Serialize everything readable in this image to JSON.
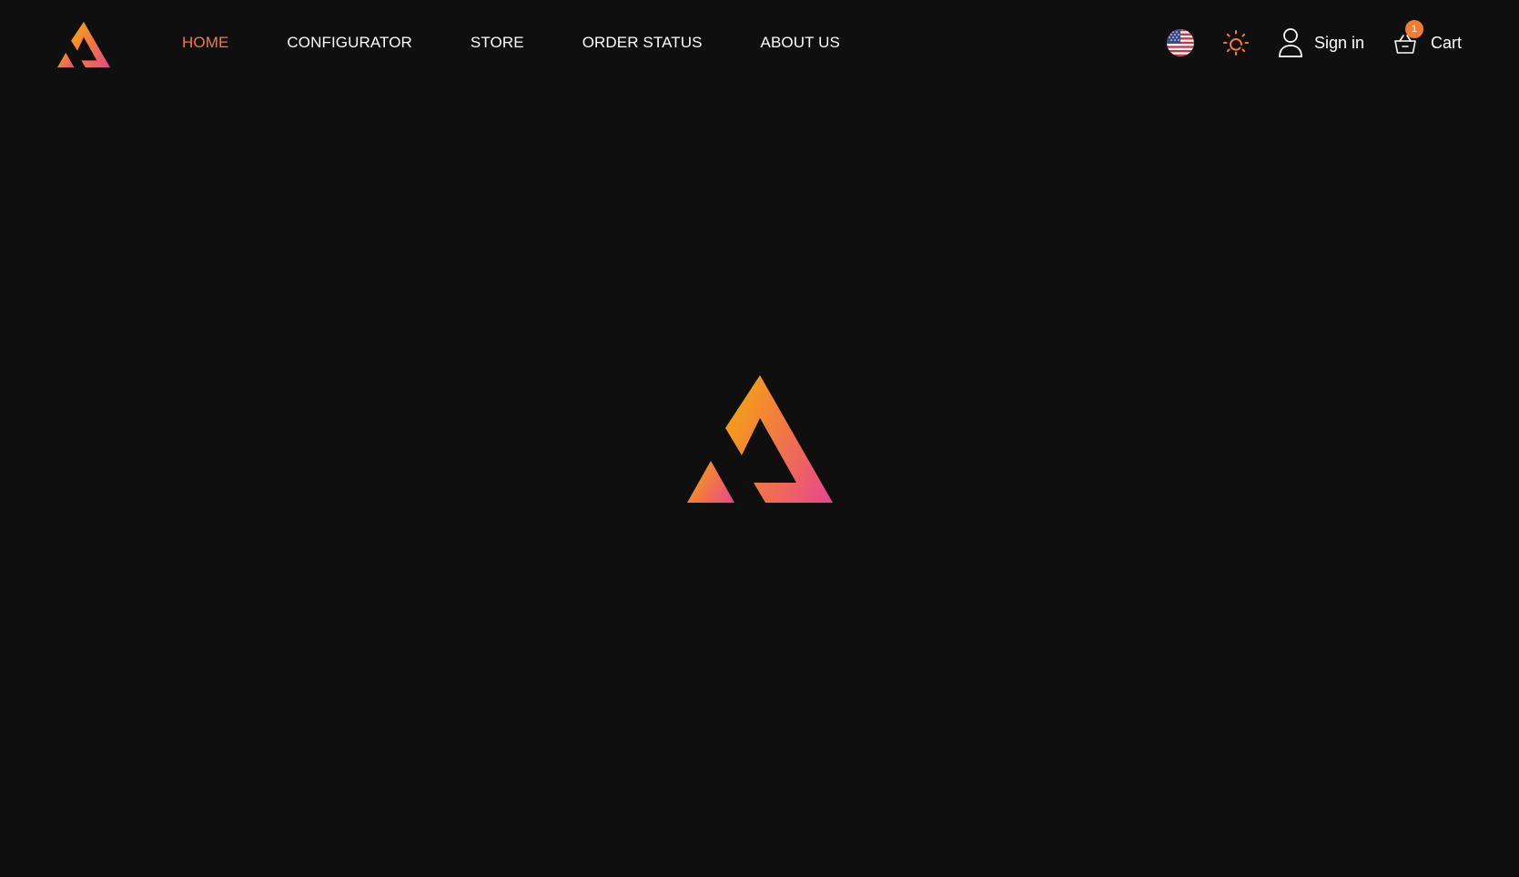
{
  "nav": {
    "items": [
      {
        "label": "HOME",
        "active": true
      },
      {
        "label": "CONFIGURATOR",
        "active": false
      },
      {
        "label": "STORE",
        "active": false
      },
      {
        "label": "ORDER STATUS",
        "active": false
      },
      {
        "label": "ABOUT US",
        "active": false
      }
    ]
  },
  "header": {
    "language_icon": "us-flag-icon",
    "theme_icon": "sun-icon",
    "signin_label": "Sign in",
    "cart_label": "Cart",
    "cart_count": "1"
  },
  "colors": {
    "background": "#0f0f0f",
    "accent": "#f27c30",
    "gradient_start": "#f59a1c",
    "gradient_end": "#e8458f",
    "text": "#ffffff"
  }
}
